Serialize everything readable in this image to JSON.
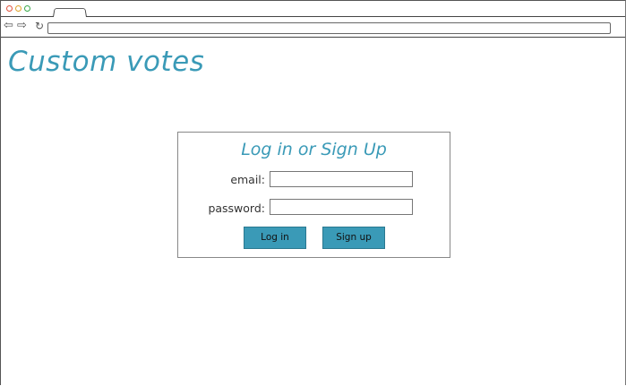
{
  "browser": {
    "dots": [
      {
        "name": "close",
        "color": "#e0503a"
      },
      {
        "name": "minimize",
        "color": "#e0a32a"
      },
      {
        "name": "maximize",
        "color": "#3aa84a"
      }
    ],
    "back_icon": "⇦",
    "forward_icon": "⇨",
    "reload_icon": "↻",
    "url_value": ""
  },
  "page": {
    "title": "Custom votes"
  },
  "login": {
    "heading": "Log in or Sign Up",
    "email_label": "email:",
    "email_value": "",
    "password_label": "password:",
    "password_value": "",
    "login_button": "Log in",
    "signup_button": "Sign up"
  },
  "colors": {
    "accent": "#3a9ab7"
  }
}
